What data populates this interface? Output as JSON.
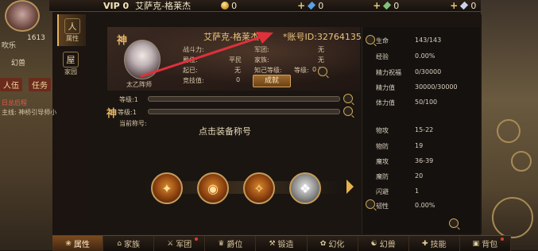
{
  "topbar": {
    "vip": "VIP 0",
    "player_name": "艾萨克-格莱杰",
    "gold": "0",
    "gem": "0",
    "bound_gem": "0",
    "silver": "0"
  },
  "left_hud": {
    "level_badge": "1613",
    "chat_frag_1": "吹乐",
    "chat_frag_2": "幻兽",
    "tab_left": "人伍",
    "tab_right": "任务",
    "quest_title": "日总后程",
    "quest_desc": "主线: 神桥引导师小"
  },
  "vtabs": [
    {
      "label": "属性",
      "icon": "人"
    },
    {
      "label": "家园",
      "icon": "屋"
    }
  ],
  "profile": {
    "name": "艾萨克-格莱杰",
    "account_id": "*账号ID:32764135*",
    "class_name": "太乙阵师",
    "fields": {
      "combat_power_label": "战斗力:",
      "combat_power_value": "",
      "rank_label": "爵位:",
      "rank_value": "平民",
      "bond_label": "起已:",
      "bond_value": "无",
      "arena_label": "竞技值:",
      "arena_value": "0",
      "legion_label": "军团:",
      "legion_value": "无",
      "family_label": "家族:",
      "family_value": "无",
      "intimacy_label": "知己等级:",
      "intimacy_value": "无",
      "confidant_level_label": "等级:",
      "confidant_level_value": "0"
    },
    "achievement_button": "成就",
    "level_row": "等级:1",
    "shen_level_row": "等级:1",
    "current_title_label": "当前称号:",
    "equip_title_prompt": "点击装备称号",
    "shen_glyph": "神"
  },
  "skills": [
    {
      "name": "fire-slash",
      "glyph": "✦"
    },
    {
      "name": "meditation",
      "glyph": "◉"
    },
    {
      "name": "blade-ring",
      "glyph": "✧"
    },
    {
      "name": "spirit",
      "glyph": "❖"
    }
  ],
  "stats": [
    {
      "label": "生命",
      "value": "143/143",
      "icon": true
    },
    {
      "label": "经验",
      "value": "0.00%"
    },
    {
      "label": "精力祝福",
      "value": "0/30000"
    },
    {
      "label": "精力值",
      "value": "30000/30000"
    },
    {
      "label": "体力值",
      "value": "50/100"
    },
    {
      "label": "物攻",
      "value": "15-22"
    },
    {
      "label": "物防",
      "value": "19"
    },
    {
      "label": "魔攻",
      "value": "36-39"
    },
    {
      "label": "魔防",
      "value": "20"
    },
    {
      "label": "闪避",
      "value": "1"
    },
    {
      "label": "韧性",
      "value": "0.00%",
      "icon": true
    }
  ],
  "bottom_tabs": [
    {
      "label": "属性",
      "icon": "❀",
      "active": true,
      "dot": false
    },
    {
      "label": "家族",
      "icon": "⌂",
      "active": false,
      "dot": false
    },
    {
      "label": "军团",
      "icon": "⚔",
      "active": false,
      "dot": true
    },
    {
      "label": "爵位",
      "icon": "♛",
      "active": false,
      "dot": false
    },
    {
      "label": "锻造",
      "icon": "⚒",
      "active": false,
      "dot": false
    },
    {
      "label": "幻化",
      "icon": "✿",
      "active": false,
      "dot": false
    },
    {
      "label": "幻兽",
      "icon": "☯",
      "active": false,
      "dot": false
    },
    {
      "label": "技能",
      "icon": "✚",
      "active": false,
      "dot": false
    },
    {
      "label": "背包",
      "icon": "▣",
      "active": false,
      "dot": true
    }
  ],
  "colors": {
    "accent_gold": "#e9c37a",
    "annotation_red": "#e0303a",
    "notification_dot": "#e23b2a"
  }
}
